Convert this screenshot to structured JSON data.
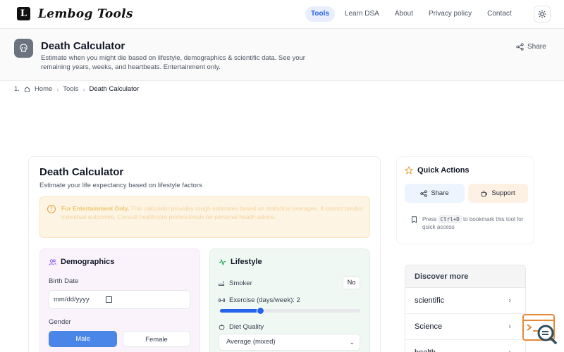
{
  "nav": {
    "logo_letter": "L",
    "brand": "Lembog Tools",
    "links": [
      "Tools",
      "Learn DSA",
      "About",
      "Privacy policy",
      "Contact"
    ],
    "active_link": "Tools"
  },
  "header": {
    "title": "Death Calculator",
    "description": "Estimate when you might die based on lifestyle, demographics & scientific data. See your remaining years, weeks, and heartbeats. Entertainment only.",
    "share_label": "Share"
  },
  "breadcrumb": {
    "index": "1.",
    "items": [
      "Home",
      "Tools",
      "Death Calculator"
    ]
  },
  "main": {
    "title": "Death Calculator",
    "subtitle": "Estimate your life expectancy based on lifestyle factors",
    "warning_bold": "For Entertainment Only.",
    "warning_text": " This calculator provides rough estimates based on statistical averages. It cannot predict individual outcomes. Consult healthcare professionals for personal health advice.",
    "demographics": {
      "title": "Demographics",
      "birth_label": "Birth Date",
      "birth_placeholder": "mm/dd/yyyy",
      "gender_label": "Gender",
      "gender_options": [
        "Male",
        "Female"
      ],
      "gender_selected": "Male"
    },
    "lifestyle": {
      "title": "Lifestyle",
      "smoker_label": "Smoker",
      "smoker_value": "No",
      "exercise_label": "Exercise (days/week): 2",
      "exercise_value": 2,
      "exercise_max": 7,
      "diet_label": "Diet Quality",
      "diet_value": "Average (mixed)"
    }
  },
  "quick_actions": {
    "title": "Quick Actions",
    "share_label": "Share",
    "support_label": "Support",
    "hint_pre": "Press ",
    "hint_key": "Ctrl+D",
    "hint_post": " to bookmark this tool for quick access"
  },
  "discover": {
    "title": "Discover more",
    "items": [
      "scientific",
      "Science",
      "health"
    ]
  },
  "colors": {
    "accent": "#2563eb",
    "male_button": "#4a86e8",
    "warning_bg": "#fdf4e4",
    "demographics_bg": "#fbf3fb",
    "lifestyle_bg": "#f0f8f3"
  }
}
